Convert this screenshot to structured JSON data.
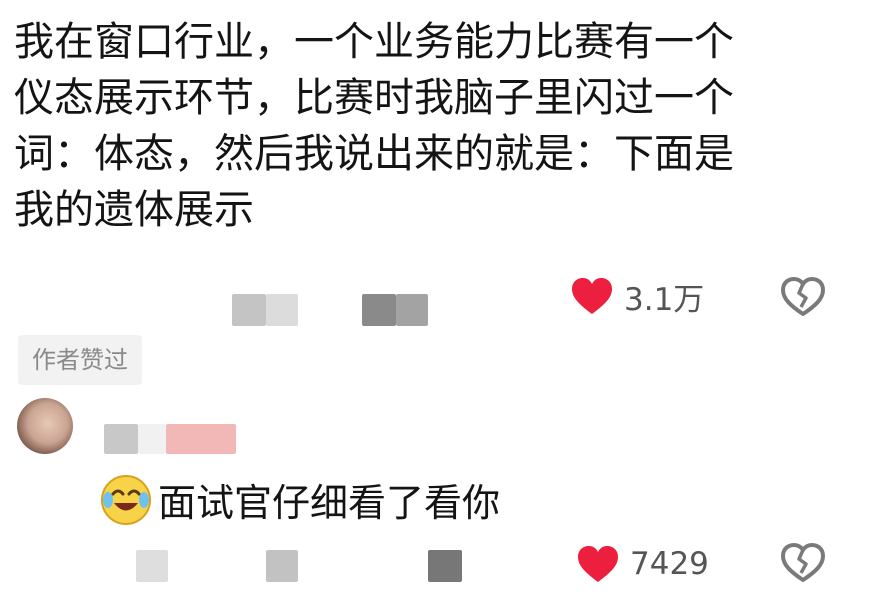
{
  "main_comment": {
    "text": "我在窗口行业，一个业务能力比赛有一个\n仪态展示环节，比赛时我脑子里闪过一个\n词：体态，然后我说出来的就是：下面是\n我的遗体展示",
    "likes": "3.1万"
  },
  "author_liked_badge": "作者赞过",
  "reply": {
    "text": "面试官仔细看了看你",
    "likes": "7429",
    "emoji_icon": "crying-laughing-emoji"
  },
  "colors": {
    "heart": "#ec1f3f",
    "broken_heart": "#7a7a7a",
    "badge_bg": "#f2f2f2"
  }
}
